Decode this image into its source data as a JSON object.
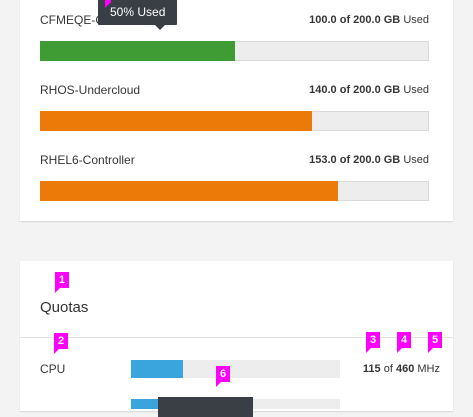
{
  "storage": {
    "tooltip": "50% Used",
    "rows": [
      {
        "name": "CFMEQE-C",
        "used": "100.0",
        "total": "of 200.0 GB",
        "unit": "Used",
        "percent": 50,
        "color": "#3f9c35"
      },
      {
        "name": "RHOS-Undercloud",
        "used": "140.0",
        "total": "of 200.0 GB",
        "unit": "Used",
        "percent": 70,
        "color": "#ec7a08"
      },
      {
        "name": "RHEL6-Controller",
        "used": "153.0",
        "total": "of 200.0 GB",
        "unit": "Used",
        "percent": 76.5,
        "color": "#ec7a08"
      }
    ]
  },
  "quotas": {
    "title": "Quotas",
    "cpu": {
      "label": "CPU",
      "used": "115",
      "of": "of",
      "total": "460",
      "unit": "MHz",
      "percent": 25,
      "color": "#39a5dc"
    },
    "second": {
      "percent": 14,
      "color": "#39a5dc"
    }
  },
  "badges": [
    "1",
    "2",
    "3",
    "4",
    "5",
    "6"
  ],
  "colors": {
    "tooltip_bg": "#393f44",
    "badge": "#ff00ff"
  }
}
